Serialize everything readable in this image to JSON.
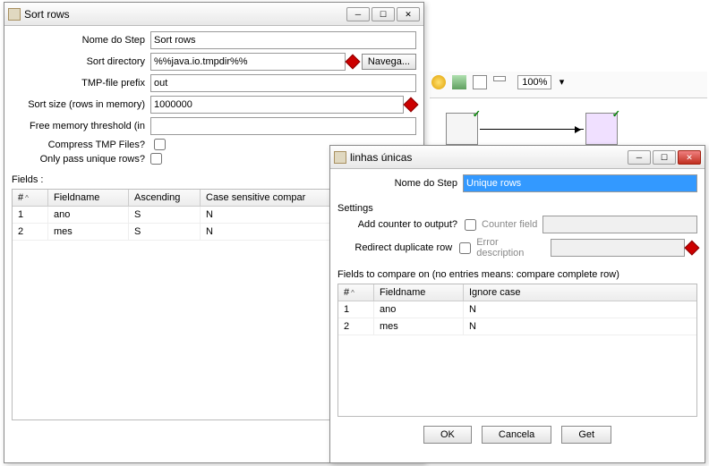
{
  "toolbar": {
    "zoom": "100%"
  },
  "sortWin": {
    "title": "Sort rows",
    "labels": {
      "stepName": "Nome do Step",
      "sortDir": "Sort directory",
      "tmpPrefix": "TMP-file prefix",
      "sortSize": "Sort size (rows in memory)",
      "freeMem": "Free memory threshold (in",
      "compress": "Compress TMP Files?",
      "unique": "Only pass unique rows?",
      "browse": "Navega...",
      "fields": "Fields :"
    },
    "values": {
      "stepName": "Sort rows",
      "sortDir": "%%java.io.tmpdir%%",
      "tmpPrefix": "out",
      "sortSize": "1000000",
      "freeMem": ""
    },
    "grid": {
      "headers": [
        "#",
        "Fieldname",
        "Ascending",
        "Case sensitive compar"
      ],
      "rows": [
        [
          "1",
          "ano",
          "S",
          "N"
        ],
        [
          "2",
          "mes",
          "S",
          "N"
        ]
      ]
    }
  },
  "uniqWin": {
    "title": "linhas únicas",
    "labels": {
      "stepName": "Nome do Step",
      "settings": "Settings",
      "addCounter": "Add counter to output?",
      "counterField": "Counter field",
      "redirect": "Redirect duplicate row",
      "errorDesc": "Error description",
      "fieldsCompare": "Fields to compare on (no entries means: compare complete row)",
      "ok": "OK",
      "cancel": "Cancela",
      "get": "Get"
    },
    "values": {
      "stepName": "Unique rows"
    },
    "grid": {
      "headers": [
        "#",
        "Fieldname",
        "Ignore case"
      ],
      "rows": [
        [
          "1",
          "ano",
          "N"
        ],
        [
          "2",
          "mes",
          "N"
        ]
      ]
    }
  }
}
